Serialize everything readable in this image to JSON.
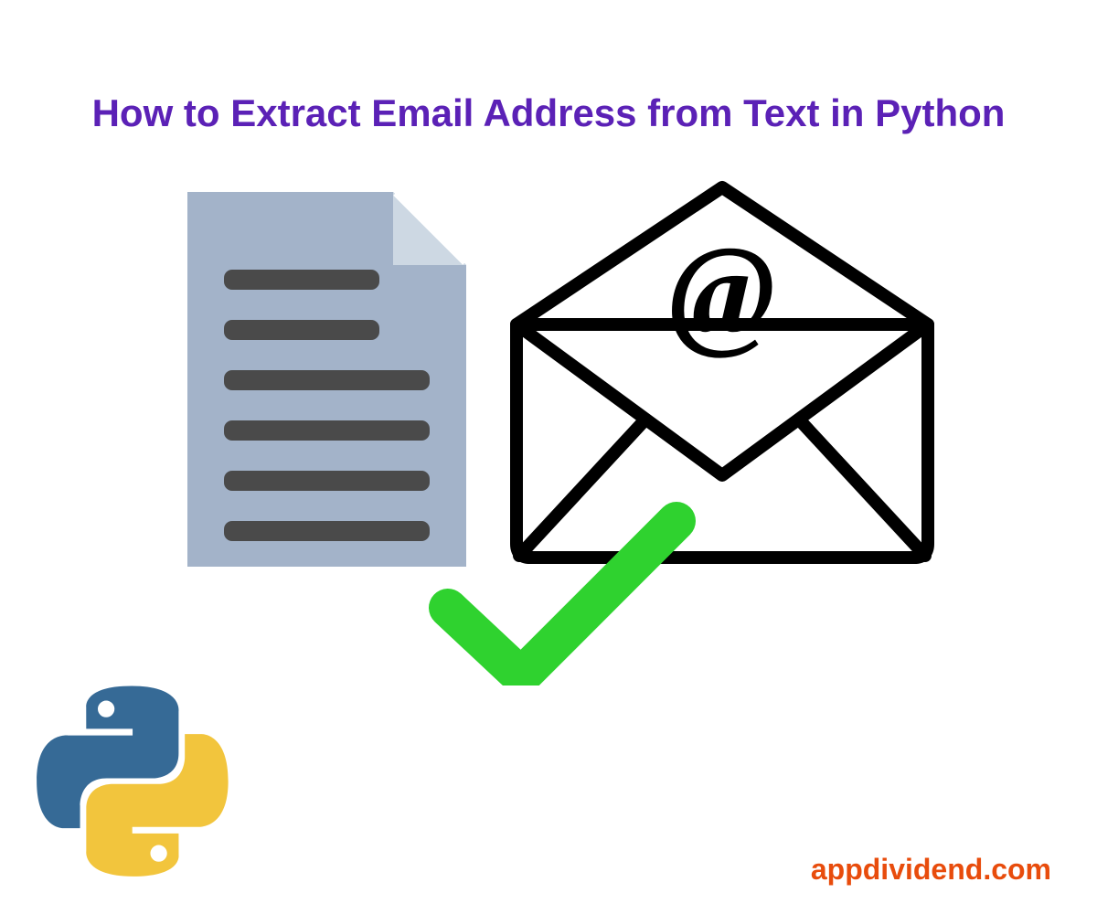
{
  "title": "How to Extract Email Address from Text in Python",
  "website": "appdividend.com",
  "colors": {
    "title": "#5B21B6",
    "website": "#E84C0C",
    "doc_fill": "#A3B3C9",
    "doc_text": "#4A4A4A",
    "check": "#2FD22F",
    "python_blue": "#366A96",
    "python_yellow": "#F2C53D"
  },
  "icons": {
    "document": "document-icon",
    "envelope": "email-envelope-icon",
    "checkmark": "checkmark-icon",
    "python": "python-logo-icon"
  }
}
